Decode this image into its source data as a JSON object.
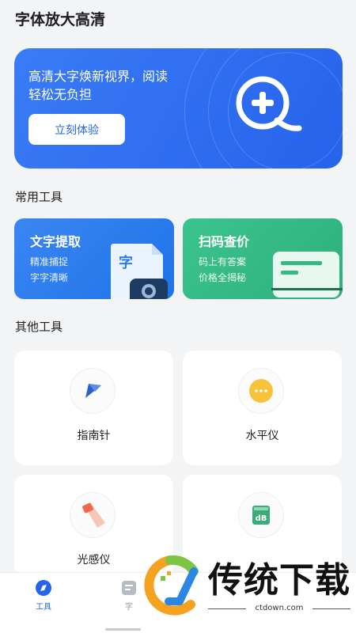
{
  "app": {
    "title": "字体放大高清"
  },
  "banner": {
    "headline_line1": "高清大字焕新视界，阅读",
    "headline_line2": "轻松无负担",
    "button_label": "立刻体验",
    "icon": "zoom-plus-icon"
  },
  "sections": {
    "common_tools": "常用工具",
    "other_tools": "其他工具"
  },
  "tool_cards": [
    {
      "title": "文字提取",
      "desc_line1": "精准捕捉",
      "desc_line2": "字字清晰",
      "icon": "text-document-camera-icon",
      "color": "#2a7cf0",
      "icon_char": "字"
    },
    {
      "title": "扫码查价",
      "desc_line1": "码上有答案",
      "desc_line2": "价格全揭秘",
      "icon": "scan-card-icon",
      "color": "#34b985"
    }
  ],
  "grid": [
    {
      "label": "指南针",
      "icon": "compass-icon"
    },
    {
      "label": "水平仪",
      "icon": "level-icon"
    },
    {
      "label": "光感仪",
      "icon": "light-sensor-icon"
    },
    {
      "label": "",
      "icon": "decibel-meter-icon",
      "icon_text": "dB"
    }
  ],
  "bottom_nav": [
    {
      "label": "工具",
      "icon": "compass-nav-icon",
      "active": true
    },
    {
      "label": "字",
      "icon": "text-nav-icon",
      "active": false
    }
  ],
  "watermark": {
    "text": "传统下载",
    "sub": "ctdown.com"
  },
  "colors": {
    "primary": "#2563eb",
    "green": "#34b985",
    "background": "#f3f4f6"
  }
}
